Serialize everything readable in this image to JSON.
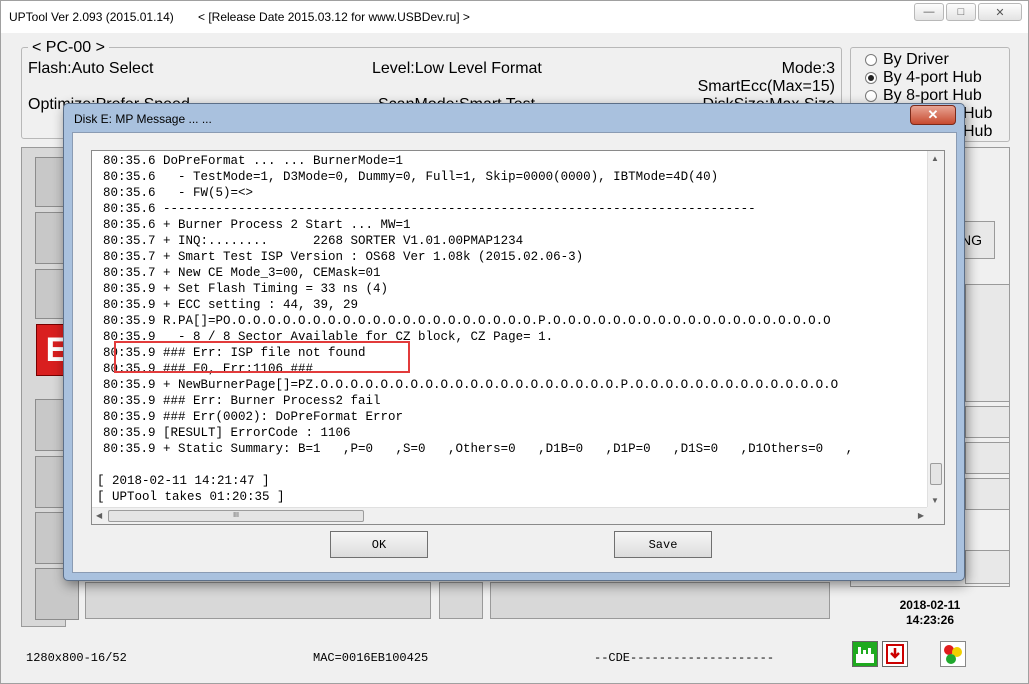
{
  "window": {
    "title": "UPTool Ver 2.093 (2015.01.14)",
    "subtitle": "< [Release Date 2015.03.12 for www.USBDev.ru] >",
    "min_glyph": "—",
    "max_glyph": "□",
    "close_glyph": "✕"
  },
  "info": {
    "legend": "< PC-00 >",
    "flash": "Flash:Auto Select",
    "level": "Level:Low Level Format",
    "mode": "Mode:3",
    "smartecc": "SmartEcc(Max=15)",
    "optimize": "Optimize:Prefer Speed",
    "scanmode": "ScanMode:Smart Test",
    "disksize": "DiskSize:Max Size"
  },
  "radio_options": [
    {
      "label": "By Driver",
      "selected": false
    },
    {
      "label": "By 4-port Hub",
      "selected": true
    },
    {
      "label": "By 8-port Hub",
      "selected": false
    },
    {
      "label": "Hub",
      "selected": false
    },
    {
      "label": "Hub",
      "selected": false
    }
  ],
  "port_badge": "E",
  "right_button": "NG",
  "datetime": {
    "date": "2018-02-11",
    "time": "14:23:26"
  },
  "status": {
    "resolution": "1280x800-16/52",
    "mac": "MAC=0016EB100425",
    "cde": "--CDE--------------------"
  },
  "dialog": {
    "title": "Disk E: MP Message ... ...",
    "close_glyph": "✕",
    "log": [
      "80:35.6 DoPreFormat ... ... BurnerMode=1",
      "80:35.6   - TestMode=1, D3Mode=0, Dummy=0, Full=1, Skip=0000(0000), IBTMode=4D(40)",
      "80:35.6   - FW(5)=<>",
      "80:35.6 -------------------------------------------------------------------------------",
      "80:35.6 + Burner Process 2 Start ... MW=1",
      "80:35.7 + INQ:........      2268 SORTER V1.01.00PMAP1234",
      "80:35.7 + Smart Test ISP Version : OS68 Ver 1.08k (2015.02.06-3)",
      "80:35.7 + New CE Mode_3=00, CEMask=01",
      "80:35.9 + Set Flash Timing = 33 ns (4)",
      "80:35.9 + ECC setting : 44, 39, 29",
      "80:35.9 R.PA[]=PO.O.O.O.O.O.O.O.O.O.O.O.O.O.O.O.O.O.O.O.O.P.O.O.O.O.O.O.O.O.O.O.O.O.O.O.O.O.O.O.O",
      "80:35.9   - 8 / 8 Sector Available for CZ block, CZ Page= 1.",
      "80:35.9 ### Err: ISP file not found",
      "80:35.9 ### F0, Err:1106 ###",
      "80:35.9 + NewBurnerPage[]=PZ.O.O.O.O.O.O.O.O.O.O.O.O.O.O.O.O.O.O.O.O.P.O.O.O.O.O.O.O.O.O.O.O.O.O.O",
      "80:35.9 ### Err: Burner Process2 fail",
      "80:35.9 ### Err(0002): DoPreFormat Error",
      "80:35.9 [RESULT] ErrorCode : 1106",
      "80:35.9 + Static Summary: B=1   ,P=0   ,S=0   ,Others=0   ,D1B=0   ,D1P=0   ,D1S=0   ,D1Others=0   ,",
      "",
      "[ 2018-02-11 14:21:47 ]",
      "[ UPTool takes 01:20:35 ]"
    ],
    "hscroll_grip": "III",
    "ok_label": "OK",
    "save_label": "Save"
  }
}
